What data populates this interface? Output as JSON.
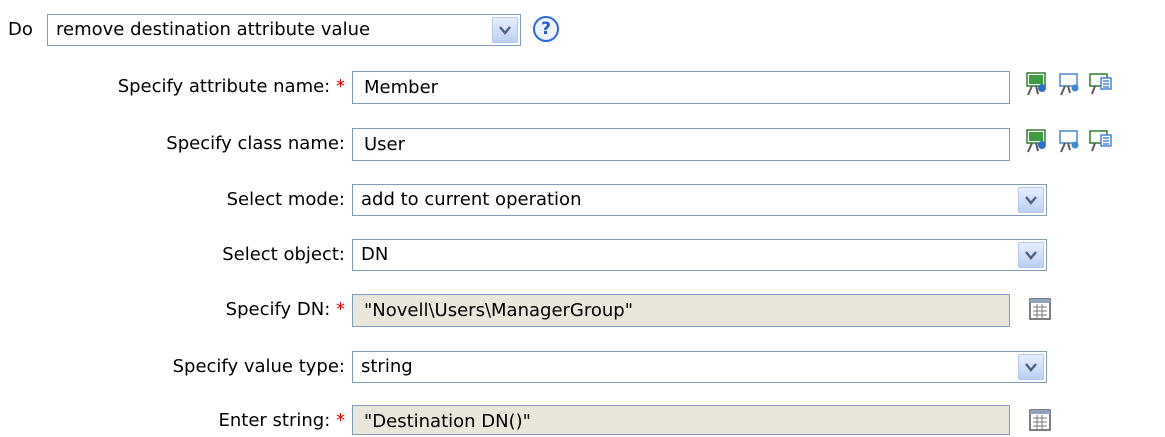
{
  "action": {
    "do_label": "Do",
    "selected": "remove destination attribute value"
  },
  "help_icon_glyph": "?",
  "fields": {
    "attribute_name": {
      "label": "Specify attribute name:",
      "required": true,
      "value": "Member"
    },
    "class_name": {
      "label": "Specify class name:",
      "value": "User"
    },
    "select_mode": {
      "label": "Select mode:",
      "value": "add to current operation"
    },
    "select_object": {
      "label": "Select object:",
      "value": "DN"
    },
    "dn": {
      "label": "Specify DN:",
      "required": true,
      "value": "\"Novell\\Users\\ManagerGroup\""
    },
    "value_type": {
      "label": "Specify value type:",
      "value": "string"
    },
    "enter_string": {
      "label": "Enter string:",
      "required": true,
      "value": "\"Destination DN()\""
    }
  },
  "required_marker": "*",
  "icons": {
    "browse": "browse-schema-icon",
    "schema": "show-schema-icon",
    "lookup": "lookup-icon",
    "editor": "argument-builder-icon"
  },
  "colors": {
    "border": "#7f9db9",
    "readonly_bg": "#ebe6db",
    "required": "#e00000",
    "help": "#2a6bd8"
  }
}
